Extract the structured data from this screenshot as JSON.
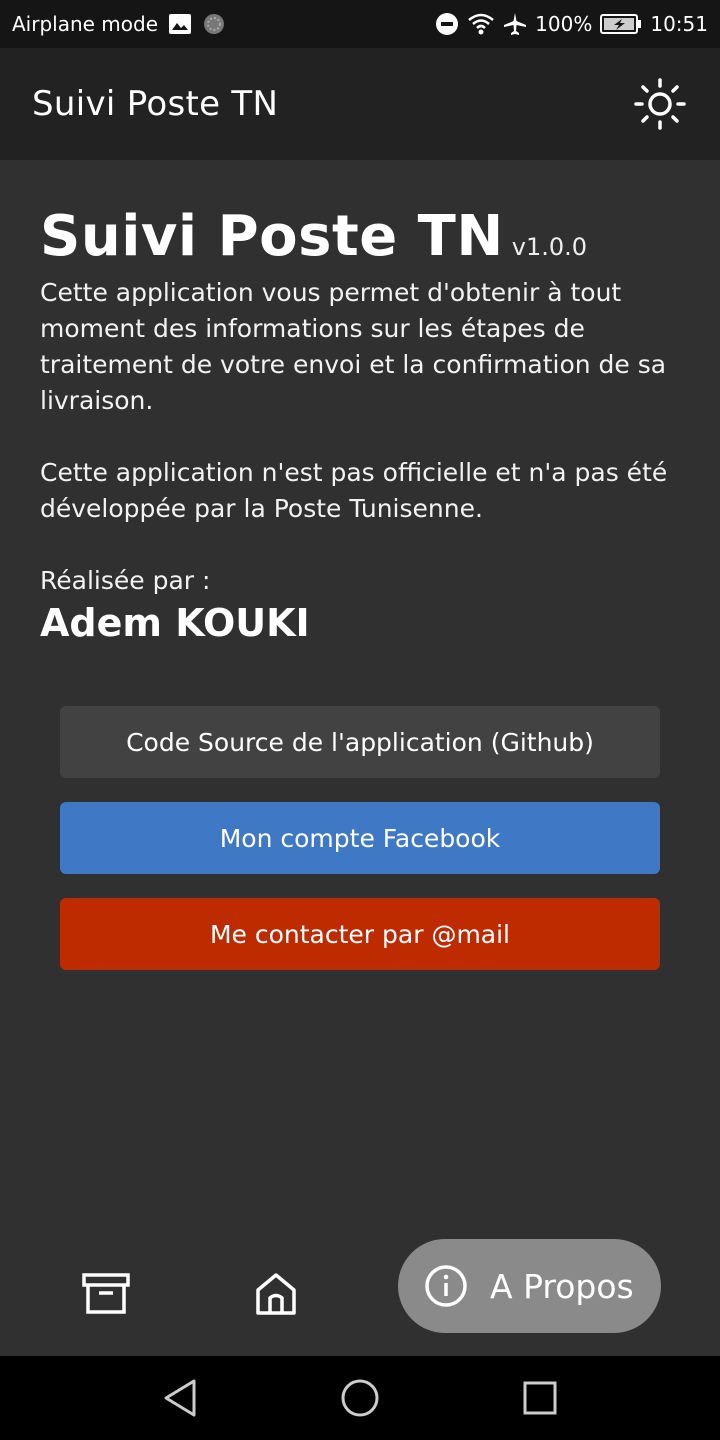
{
  "status_bar": {
    "mode_text": "Airplane mode",
    "battery": "100%",
    "time": "10:51"
  },
  "app_bar": {
    "title": "Suivi Poste TN"
  },
  "about": {
    "title": "Suivi Poste TN",
    "version": "v1.0.0",
    "description": "Cette application vous permet d'obtenir à tout moment des informations sur les étapes de traitement de votre envoi et la confirmation de sa livraison.",
    "disclaimer": "Cette application n'est pas officielle et n'a pas été développée par la Poste Tunisenne.",
    "made_by_label": "Réalisée par :",
    "author": "Adem KOUKI"
  },
  "buttons": {
    "github": "Code Source de l'application (Github)",
    "facebook": "Mon compte Facebook",
    "mail": "Me contacter par @mail"
  },
  "bottom_nav": {
    "active_label": "A Propos"
  },
  "colors": {
    "facebook": "#3f78c4",
    "mail": "#bf2b00",
    "github": "#424242"
  }
}
